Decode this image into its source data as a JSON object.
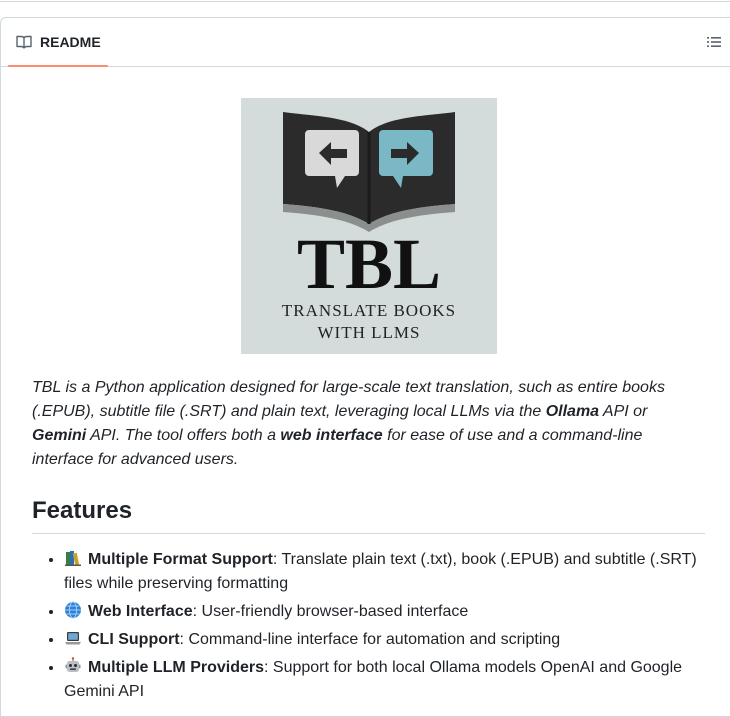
{
  "readme": {
    "tab_label": "README",
    "outline_label": "Outline"
  },
  "logo": {
    "title": "TBL",
    "subtitle_line1": "TRANSLATE BOOKS",
    "subtitle_line2": "WITH LLMS",
    "background": "#d3dcdb",
    "book_color": "#2b2b2b",
    "left_bubble_color": "#d9d9d9",
    "right_bubble_color": "#7ab8c6"
  },
  "intro": {
    "part1": "TBL is a Python application designed for large-scale text translation, such as entire books (.EPUB), subtitle file (.SRT) and plain text, leveraging local LLMs via the ",
    "ollama": "Ollama",
    "part2": " API or ",
    "gemini": "Gemini",
    "part3": " API. The tool offers both a ",
    "web_interface": "web interface",
    "part4": " for ease of use and a command-line interface for advanced users."
  },
  "features": {
    "heading": "Features",
    "items": [
      {
        "icon": "books-icon",
        "title": "Multiple Format Support",
        "text": ": Translate plain text (.txt), book (.EPUB) and subtitle (.SRT) files while preserving formatting"
      },
      {
        "icon": "globe-icon",
        "title": "Web Interface",
        "text": ": User-friendly browser-based interface"
      },
      {
        "icon": "laptop-icon",
        "title": "CLI Support",
        "text": ": Command-line interface for automation and scripting"
      },
      {
        "icon": "robot-icon",
        "title": "Multiple LLM Providers",
        "text": ": Support for both local Ollama models OpenAI and Google Gemini API"
      }
    ]
  }
}
